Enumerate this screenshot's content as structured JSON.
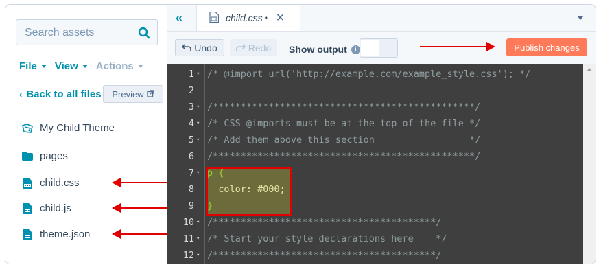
{
  "sidebar": {
    "search": {
      "placeholder": "Search assets",
      "icon": "search-icon"
    },
    "menus": [
      {
        "label": "File",
        "enabled": true
      },
      {
        "label": "View",
        "enabled": true
      },
      {
        "label": "Actions",
        "enabled": false
      }
    ],
    "back_label": "Back to all files",
    "preview_label": "Preview",
    "files": [
      {
        "label": "My Child Theme",
        "icon": "theme-icon"
      },
      {
        "label": "pages",
        "icon": "folder-icon"
      },
      {
        "label": "child.css",
        "icon": "css-file-icon"
      },
      {
        "label": "child.js",
        "icon": "js-file-icon"
      },
      {
        "label": "theme.json",
        "icon": "json-file-icon"
      }
    ]
  },
  "tab": {
    "name": "child.css",
    "dirty_marker": "•",
    "close": "✕",
    "collapse": "«"
  },
  "toolbar": {
    "undo_label": "Undo",
    "redo_label": "Redo",
    "show_output_label": "Show output",
    "info": "i",
    "publish_label": "Publish changes"
  },
  "code": {
    "lines": [
      {
        "n": "1",
        "text": "/* @import url('http://example.com/example_style.css'); */",
        "fold": true
      },
      {
        "n": "2",
        "text": "",
        "fold": false
      },
      {
        "n": "3",
        "text": "/***********************************************/",
        "fold": true
      },
      {
        "n": "4",
        "text": "/* CSS @imports must be at the top of the file */",
        "fold": true
      },
      {
        "n": "5",
        "text": "/* Add them above this section                 */",
        "fold": true
      },
      {
        "n": "6",
        "text": "/***********************************************/",
        "fold": false
      },
      {
        "n": "7",
        "text": "p {",
        "fold": true
      },
      {
        "n": "8",
        "text": "  color: #000;",
        "fold": false
      },
      {
        "n": "9",
        "text": "}",
        "fold": false
      },
      {
        "n": "10",
        "text": "/****************************************/",
        "fold": true
      },
      {
        "n": "11",
        "text": "/* Start your style declarations here    */",
        "fold": true
      },
      {
        "n": "12",
        "text": "/****************************************/",
        "fold": true
      }
    ]
  },
  "colors": {
    "accent": "#0091ae",
    "publish": "#ff7a59",
    "annotation": "#e00000",
    "editor_bg": "#3f3f3f"
  }
}
